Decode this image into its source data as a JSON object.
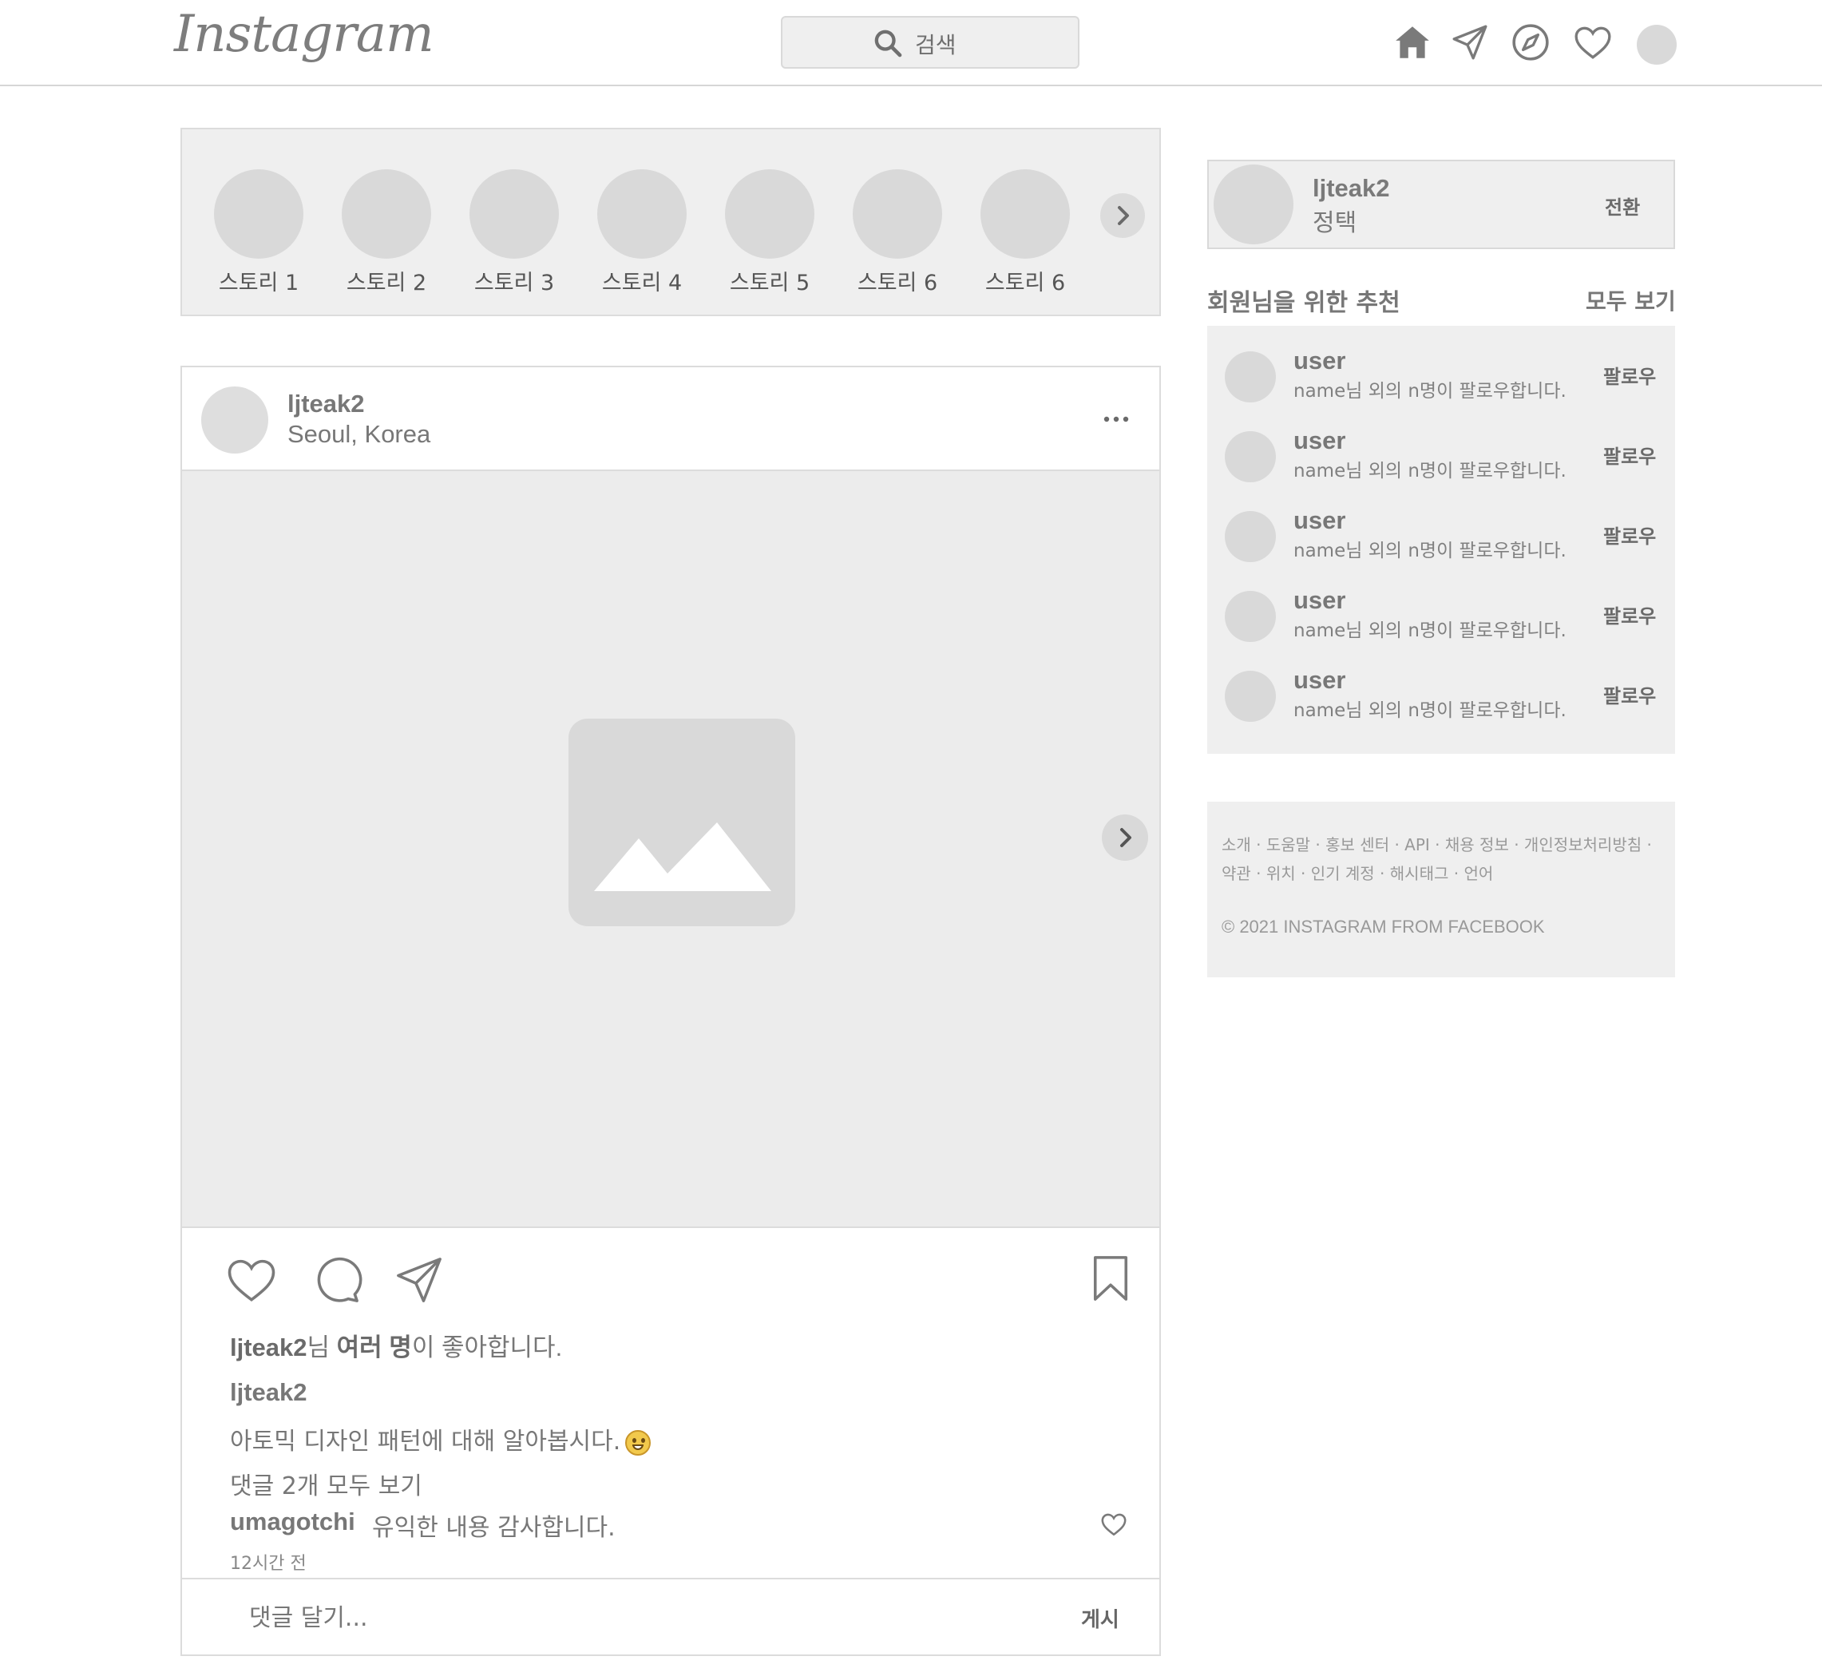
{
  "header": {
    "logo_text": "Instagram",
    "search_placeholder": "검색",
    "nav_icons": [
      "home-icon",
      "direct-message-icon",
      "explore-icon",
      "activity-heart-icon",
      "profile-avatar"
    ]
  },
  "stories": [
    {
      "label": "스토리 1"
    },
    {
      "label": "스토리 2"
    },
    {
      "label": "스토리 3"
    },
    {
      "label": "스토리 4"
    },
    {
      "label": "스토리 5"
    },
    {
      "label": "스토리 6"
    },
    {
      "label": "스토리 6"
    }
  ],
  "post": {
    "username": "ljteak2",
    "location": "Seoul, Korea",
    "likes": {
      "prefix": "ljteak2",
      "mid": "님 ",
      "bold": "여러 명",
      "suffix": "이 좋아합니다."
    },
    "caption_user": "ljteak2",
    "caption_text": "아토믹 디자인 패턴에 대해 알아봅시다.",
    "view_comments": "댓글 2개 모두 보기",
    "comment": {
      "user": "umagotchi",
      "text": "유익한 내용 감사합니다."
    },
    "time_ago": "12시간 전",
    "comment_placeholder": "댓글 달기...",
    "post_button": "게시"
  },
  "profile": {
    "username": "ljteak2",
    "name": "정택",
    "switch_label": "전환"
  },
  "recommendations": {
    "title": "회원님을 위한 추천",
    "see_all": "모두 보기",
    "items": [
      {
        "user": "user",
        "sub": "name님 외의 n명이 팔로우합니다.",
        "follow": "팔로우"
      },
      {
        "user": "user",
        "sub": "name님 외의 n명이 팔로우합니다.",
        "follow": "팔로우"
      },
      {
        "user": "user",
        "sub": "name님 외의 n명이 팔로우합니다.",
        "follow": "팔로우"
      },
      {
        "user": "user",
        "sub": "name님 외의 n명이 팔로우합니다.",
        "follow": "팔로우"
      },
      {
        "user": "user",
        "sub": "name님 외의 n명이 팔로우합니다.",
        "follow": "팔로우"
      }
    ]
  },
  "footer": {
    "line1": "소개 · 도움말 · 홍보 센터 · API · 채용 정보 · 개인정보처리방침 ·",
    "line2": "약관 · 위치 · 인기 계정 · 해시태그 · 언어",
    "copyright": "© 2021 INSTAGRAM FROM FACEBOOK"
  },
  "colors": {
    "icon": "#7a7a7a",
    "placeholder": "#d9d9d9",
    "panel": "#efefef"
  }
}
